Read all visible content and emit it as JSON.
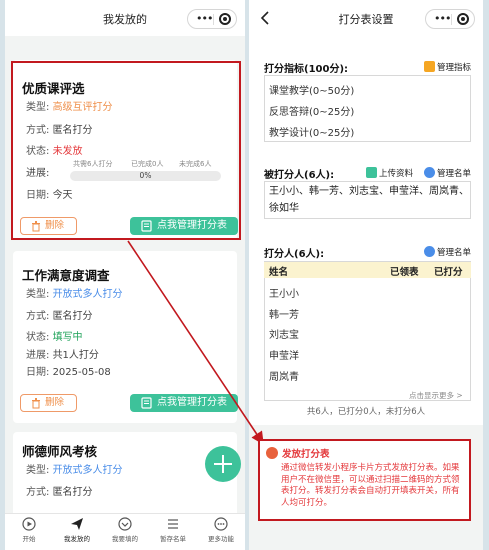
{
  "left_screen": {
    "title": "我发放的",
    "cards": [
      {
        "title": "优质课评选",
        "type_label": "类型:",
        "type_value": "高级互评打分",
        "mode_label": "方式:",
        "mode_value": "匿名打分",
        "status_label": "状态:",
        "status_value": "未发放",
        "progress_label": "进展:",
        "total_stat": "共需6人打分",
        "done_stat": "已完成0人",
        "undone_stat": "未完成6人",
        "progress_percent": "0%",
        "date_label": "日期:",
        "date_value": "今天",
        "delete_label": "删除",
        "manage_label": "点我管理打分表"
      },
      {
        "title": "工作满意度调查",
        "type_label": "类型:",
        "type_value": "开放式多人打分",
        "mode_label": "方式:",
        "mode_value": "匿名打分",
        "status_label": "状态:",
        "status_value": "填写中",
        "progress_label": "进展:",
        "progress_value": "共1人打分",
        "date_label": "日期:",
        "date_value": "2025-05-08",
        "delete_label": "删除",
        "manage_label": "点我管理打分表"
      },
      {
        "title": "师德师风考核",
        "type_label": "类型:",
        "type_value": "开放式多人打分",
        "mode_label": "方式:",
        "mode_value": "匿名打分"
      }
    ],
    "tabs": [
      "开始",
      "我发放的",
      "我要填的",
      "暂存名单",
      "更多功能"
    ]
  },
  "right_screen": {
    "title": "打分表设置",
    "criteria_title": "打分指标(100分):",
    "criteria_action": "管理指标",
    "criteria": [
      "课堂教学(0~50分)",
      "反思答辩(0~25分)",
      "教学设计(0~25分)"
    ],
    "scored_title": "被打分人(6人):",
    "upload_action": "上传资料",
    "manage_list_action": "管理名单",
    "scored_names": "王小小、韩一芳、刘志宝、申莹洋、周岚青、徐如华",
    "scorers_title": "打分人(6人):",
    "scorers_action": "管理名单",
    "table_headers": [
      "姓名",
      "已领表",
      "已打分"
    ],
    "scorers": [
      "王小小",
      "韩一芳",
      "刘志宝",
      "申莹洋",
      "周岚青"
    ],
    "more_link": "点击显示更多 >",
    "summary": "共6人，已打分0人，未打分6人"
  },
  "annotation": {
    "title": "发放打分表",
    "text": "通过微信转发小程序卡片方式发放打分表。如果用户不在微信里，可以通过扫描二维码的方式领表打分。转发打分表会自动打开填表开关，所有人均可打分。"
  },
  "colors": {
    "accent_green": "#3dc29a",
    "warning_orange": "#ef8f4a",
    "status_red": "#e4393c",
    "link_blue": "#4a8de8",
    "highlight_red": "#c2191f"
  }
}
